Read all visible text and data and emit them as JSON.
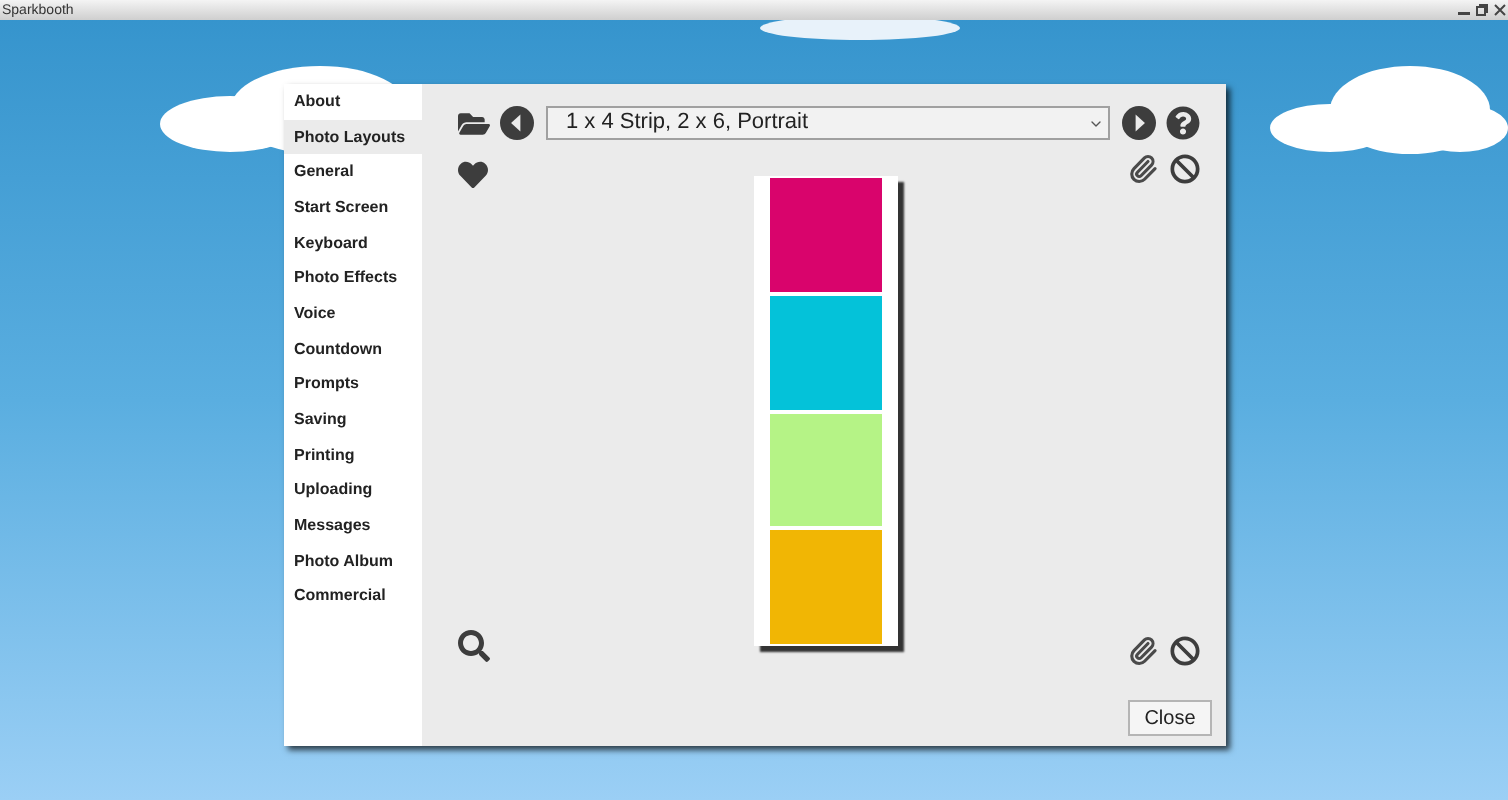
{
  "window": {
    "title": "Sparkbooth"
  },
  "sidebar": {
    "items": [
      {
        "label": "About",
        "selected": false
      },
      {
        "label": "Photo Layouts",
        "selected": true
      },
      {
        "label": "General",
        "selected": false
      },
      {
        "label": "Start Screen",
        "selected": false
      },
      {
        "label": "Keyboard",
        "selected": false
      },
      {
        "label": "Photo Effects",
        "selected": false
      },
      {
        "label": "Voice",
        "selected": false
      },
      {
        "label": "Countdown",
        "selected": false
      },
      {
        "label": "Prompts",
        "selected": false
      },
      {
        "label": "Saving",
        "selected": false
      },
      {
        "label": "Printing",
        "selected": false
      },
      {
        "label": "Uploading",
        "selected": false
      },
      {
        "label": "Messages",
        "selected": false
      },
      {
        "label": "Photo Album",
        "selected": false
      },
      {
        "label": "Commercial",
        "selected": false
      }
    ]
  },
  "layout_select": {
    "value": "1 x 4 Strip, 2 x 6, Portrait"
  },
  "strip": {
    "frames": [
      {
        "color": "#d9046c"
      },
      {
        "color": "#04c2d9"
      },
      {
        "color": "#b5f386"
      },
      {
        "color": "#f1b604"
      }
    ]
  },
  "close_button": "Close"
}
